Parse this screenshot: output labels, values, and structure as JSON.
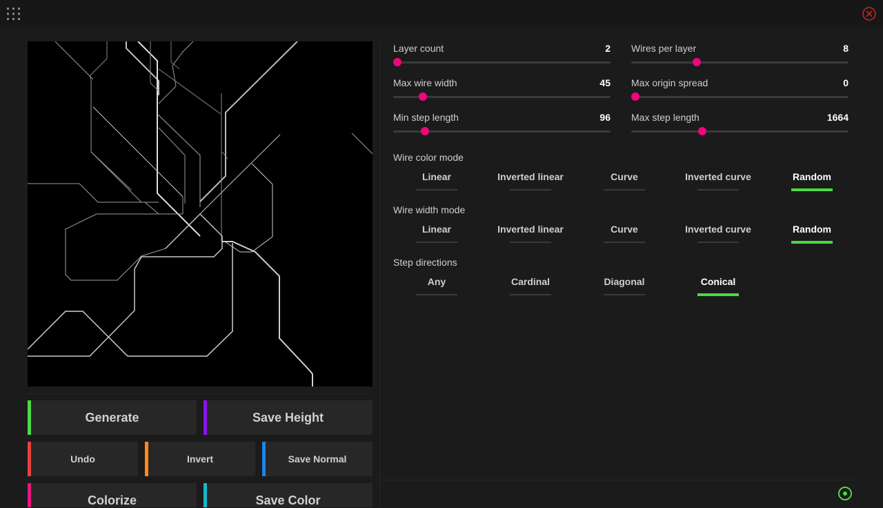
{
  "toolbar": {
    "menu_icon": "grid-icon",
    "close_icon": "close-circle-icon",
    "close_color": "#d02626"
  },
  "buttons": {
    "generate": {
      "label": "Generate",
      "color": "#4cd944"
    },
    "save_height": {
      "label": "Save Height",
      "color": "#8a13ea"
    },
    "undo": {
      "label": "Undo",
      "color": "#e8423a"
    },
    "invert": {
      "label": "Invert",
      "color": "#ff8a1a"
    },
    "save_normal": {
      "label": "Save Normal",
      "color": "#1a86e8"
    },
    "colorize": {
      "label": "Colorize",
      "color": "#ea1680"
    },
    "save_color": {
      "label": "Save Color",
      "color": "#19b8c7"
    }
  },
  "sliders": [
    {
      "label": "Layer count",
      "value": "2",
      "fraction": 0.02
    },
    {
      "label": "Wires per layer",
      "value": "8",
      "fraction": 0.3
    },
    {
      "label": "Max wire width",
      "value": "45",
      "fraction": 0.135
    },
    {
      "label": "Max origin spread",
      "value": "0",
      "fraction": 0.02
    },
    {
      "label": "Min step length",
      "value": "96",
      "fraction": 0.145
    },
    {
      "label": "Max step length",
      "value": "1664",
      "fraction": 0.327
    }
  ],
  "wire_color_mode": {
    "label": "Wire color mode",
    "options": [
      "Linear",
      "Inverted linear",
      "Curve",
      "Inverted curve",
      "Random"
    ],
    "selected": "Random"
  },
  "wire_width_mode": {
    "label": "Wire width mode",
    "options": [
      "Linear",
      "Inverted linear",
      "Curve",
      "Inverted curve",
      "Random"
    ],
    "selected": "Random"
  },
  "step_directions": {
    "label": "Step directions",
    "options": [
      "Any",
      "Cardinal",
      "Diagonal",
      "Conical"
    ],
    "selected": "Conical"
  },
  "status": {
    "icon": "target-icon",
    "color": "#4cd944"
  },
  "accent": "#f0067a"
}
